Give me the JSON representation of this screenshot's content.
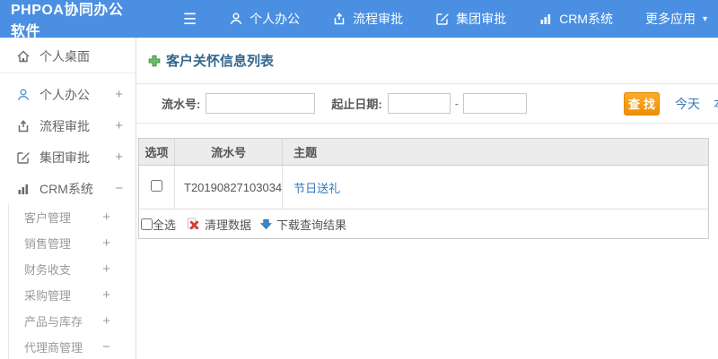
{
  "header": {
    "logo": "PHPOA协同办公软件",
    "nav": [
      {
        "label": "个人办公",
        "icon": "person-icon"
      },
      {
        "label": "流程审批",
        "icon": "workflow-icon"
      },
      {
        "label": "集团审批",
        "icon": "edit-icon"
      },
      {
        "label": "CRM系统",
        "icon": "bar-chart-icon"
      },
      {
        "label": "更多应用",
        "icon": "caret-down-icon",
        "caret": "▾"
      }
    ]
  },
  "sidebar": {
    "items": [
      {
        "label": "个人桌面",
        "icon": "home-icon",
        "toggle": ""
      },
      {
        "label": "个人办公",
        "icon": "person-icon",
        "toggle": "+"
      },
      {
        "label": "流程审批",
        "icon": "workflow-icon",
        "toggle": "+"
      },
      {
        "label": "集团审批",
        "icon": "edit-icon",
        "toggle": "+"
      },
      {
        "label": "CRM系统",
        "icon": "bar-chart-icon",
        "toggle": "−"
      }
    ],
    "subitems": [
      {
        "label": "客户管理",
        "toggle": "+"
      },
      {
        "label": "销售管理",
        "toggle": "+"
      },
      {
        "label": "财务收支",
        "toggle": "+"
      },
      {
        "label": "采购管理",
        "toggle": "+"
      },
      {
        "label": "产品与库存",
        "toggle": "+"
      },
      {
        "label": "代理商管理",
        "toggle": "−"
      }
    ]
  },
  "main": {
    "title": "客户关怀信息列表",
    "search": {
      "serial_label": "流水号:",
      "serial_value": "",
      "date_label": "起止日期:",
      "date_from_value": "",
      "date_to_value": "",
      "dash": "-",
      "find_button": "查找",
      "quick_links": [
        "今天",
        "本周"
      ]
    },
    "table": {
      "columns": [
        "选项",
        "流水号",
        "主题"
      ],
      "rows": [
        {
          "serial": "T20190827103034",
          "subject": "节日送礼"
        }
      ],
      "footer": {
        "select_all": "全选",
        "clear_data": "清理数据",
        "download_results": "下载查询结果"
      }
    }
  },
  "colors": {
    "header_blue": "#4a8fe2",
    "link_blue": "#3579b8",
    "title_navy": "#33678d",
    "button_orange": "#ef9000",
    "add_green": "#58a758",
    "delete_red": "#d63a2f",
    "table_header_gray": "#ececec"
  }
}
